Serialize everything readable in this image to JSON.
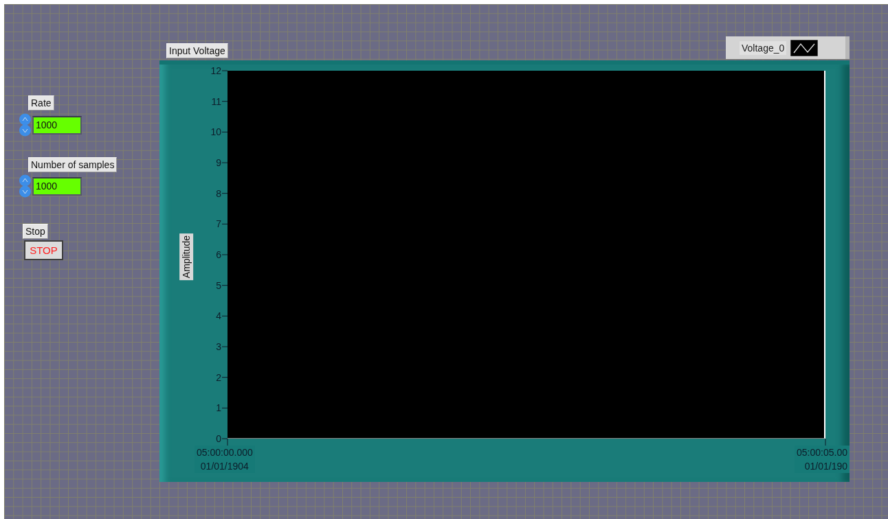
{
  "controls": [
    {
      "kind": "numeric",
      "label": "Rate",
      "value": "1000"
    },
    {
      "kind": "numeric",
      "label": "Number of samples",
      "value": "1000"
    },
    {
      "kind": "button",
      "label": "Stop",
      "text": "STOP"
    }
  ],
  "graph": {
    "label": "Input Voltage",
    "legend": [
      {
        "name": "Voltage_0"
      }
    ],
    "chart_data": {
      "type": "line",
      "ylabel": "Amplitude",
      "ylim": [
        0,
        12
      ],
      "yticks": [
        0,
        1,
        2,
        3,
        4,
        5,
        6,
        7,
        8,
        9,
        10,
        11,
        12
      ],
      "categories": [
        "05:00:00.000\n01/01/1904",
        "05:00:05.00\n01/01/190"
      ]
    }
  }
}
